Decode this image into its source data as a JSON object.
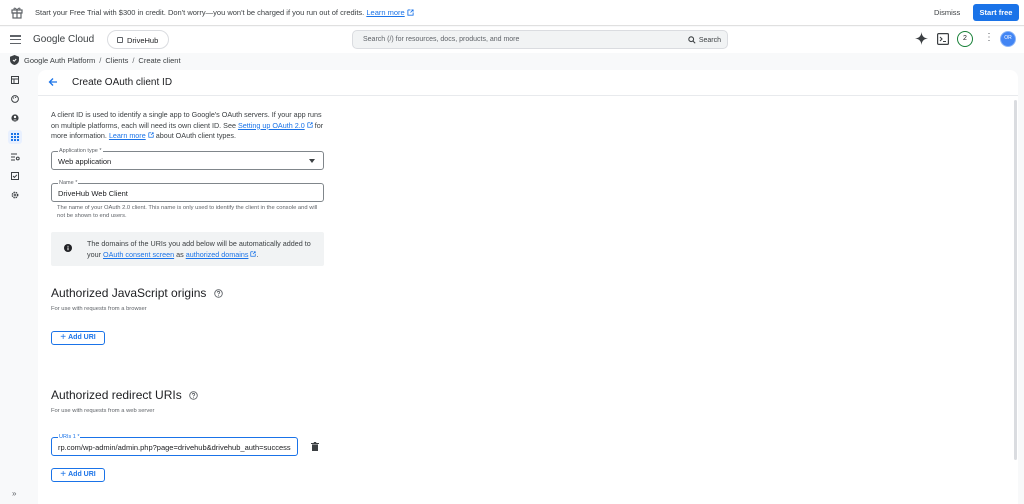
{
  "banner": {
    "message": "Start your Free Trial with $300 in credit. Don't worry—you won't be charged if you run out of credits.",
    "learn_more": "Learn more",
    "dismiss": "Dismiss",
    "start_free": "Start free"
  },
  "header": {
    "logo": "Google Cloud",
    "project": "DriveHub",
    "search_placeholder": "Search (/) for resources, docs, products, and more",
    "search_button": "Search",
    "notification_count": "2",
    "avatar_text": "OR"
  },
  "breadcrumb": {
    "items": [
      "Google Auth Platform",
      "Clients",
      "Create client"
    ]
  },
  "page": {
    "title": "Create OAuth client ID",
    "intro_text": "A client ID is used to identify a single app to Google's OAuth servers. If your app runs on multiple platforms, each will need its own client ID. See",
    "intro_link1": "Setting up OAuth 2.0",
    "intro_mid": "for more information.",
    "intro_link2": "Learn more",
    "intro_end": "about OAuth client types."
  },
  "form": {
    "app_type_label": "Application type *",
    "app_type_value": "Web application",
    "name_label": "Name *",
    "name_value": "DriveHub Web Client",
    "name_helper": "The name of your OAuth 2.0 client. This name is only used to identify the client in the console and will not be shown to end users."
  },
  "info": {
    "text_before": "The domains of the URIs you add below will be automatically added to your",
    "link1": "OAuth consent screen",
    "text_mid": "as",
    "link2": "authorized domains",
    "text_end": "."
  },
  "js_origins": {
    "title": "Authorized JavaScript origins",
    "desc": "For use with requests from a browser",
    "add_button": "Add URI"
  },
  "redirect_uris": {
    "title": "Authorized redirect URIs",
    "desc": "For use with requests from a web server",
    "uri_label": "URIs 1 *",
    "uri_value": "rp.com/wp-admin/admin.php?page=drivehub&drivehub_auth=success",
    "add_button": "Add URI"
  },
  "colors": {
    "accent": "#1a73e8",
    "success": "#188038"
  }
}
